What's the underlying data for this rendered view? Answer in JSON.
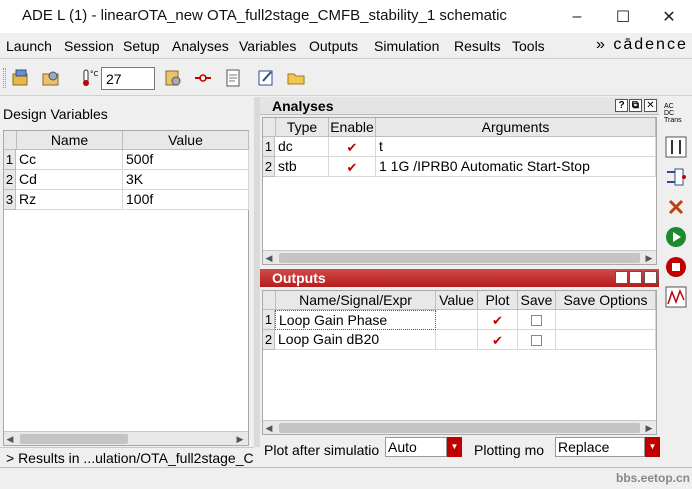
{
  "window": {
    "title": "ADE L (1) - linearOTA_new OTA_full2stage_CMFB_stability_1 schematic",
    "minimize": "–",
    "maximize": "☐",
    "close": "✕"
  },
  "menubar": {
    "items": [
      "Launch",
      "Session",
      "Setup",
      "Analyses",
      "Variables",
      "Outputs",
      "Simulation",
      "Results",
      "Tools"
    ],
    "brand": "» cādence"
  },
  "toolbar": {
    "temperature": "27",
    "temperature_icon": "thermometer-icon"
  },
  "design_variables": {
    "title": "Design Variables",
    "headers": [
      "Name",
      "Value"
    ],
    "rows": [
      {
        "n": "1",
        "name": "Cc",
        "value": "500f"
      },
      {
        "n": "2",
        "name": "Cd",
        "value": "3K"
      },
      {
        "n": "3",
        "name": "Rz",
        "value": "100f"
      }
    ]
  },
  "analyses": {
    "title": "Analyses",
    "headers": [
      "Type",
      "Enable",
      "Arguments"
    ],
    "rows": [
      {
        "n": "1",
        "type": "dc",
        "enabled": true,
        "arguments": "t"
      },
      {
        "n": "2",
        "type": "stb",
        "enabled": true,
        "arguments": "1 1G /IPRB0 Automatic Start-Stop"
      }
    ],
    "dock_buttons": [
      "?",
      "⧉",
      "✕"
    ]
  },
  "outputs": {
    "title": "Outputs",
    "headers": [
      "Name/Signal/Expr",
      "Value",
      "Plot",
      "Save",
      "Save Options"
    ],
    "rows": [
      {
        "n": "1",
        "name": "Loop Gain Phase",
        "value": "",
        "plot": true,
        "save": false
      },
      {
        "n": "2",
        "name": "Loop Gain dB20",
        "value": "",
        "plot": true,
        "save": false
      }
    ],
    "dock_buttons": [
      "?",
      "⧉",
      "✕"
    ]
  },
  "bottom": {
    "plot_after_label": "Plot after simulatio",
    "plot_after_value": "Auto",
    "plotting_mode_label": "Plotting mo",
    "plotting_mode_value": "Replace"
  },
  "status": {
    "text": "> Results in ...ulation/OTA_full2stage_C"
  },
  "side_toolbar": {
    "labels": [
      "AC",
      "DC",
      "Trans"
    ]
  },
  "watermark": "bbs.eetop.cn",
  "colors": {
    "accent_red": "#c00000",
    "dock_header_top": "#d14a4a",
    "dock_header_bottom": "#b51d1d",
    "run_green": "#1e8a2e"
  }
}
